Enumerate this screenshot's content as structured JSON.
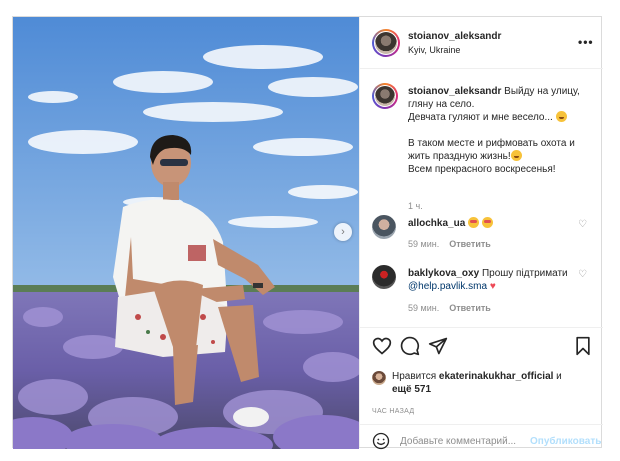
{
  "post": {
    "author": "stoianov_aleksandr",
    "location": "Kyiv, Ukraine",
    "more_icon": "more-horizontal-icon",
    "caption": {
      "username": "stoianov_aleksandr",
      "line1": " Выйду на улицу, гляну на село.",
      "line2": "Девчата гуляют и мне весело...",
      "line3": "В таком месте и рифмовать охота и жить праздную жизнь!",
      "line4": "Всем прекрасного воскресенья!",
      "time": "1 ч."
    },
    "comments": [
      {
        "username": "allochka_ua",
        "text": "",
        "time": "59 мин.",
        "reply_label": "Ответить",
        "avatar_color": "#4a5560"
      },
      {
        "username": "baklykova_oxy",
        "text": " Прошу підтримати ",
        "mention": "@help.pavlik.sma",
        "time": "59 мин.",
        "reply_label": "Ответить",
        "avatar_color": "#2b2b2b"
      }
    ],
    "likes": {
      "prefix": "Нравится ",
      "user": "ekaterinakukhar_official",
      "middle": " и ",
      "others": "ещё 571"
    },
    "post_time": "ЧАС НАЗАД",
    "add_comment": {
      "placeholder": "Добавьте комментарий...",
      "publish_label": "Опубликовать"
    },
    "colors": {
      "publish_disabled": "#b2dffc",
      "mention": "#00376b",
      "heart_red": "#ed4956",
      "sky": "#6fa0d8",
      "lavender": "#8e7bc4"
    }
  }
}
